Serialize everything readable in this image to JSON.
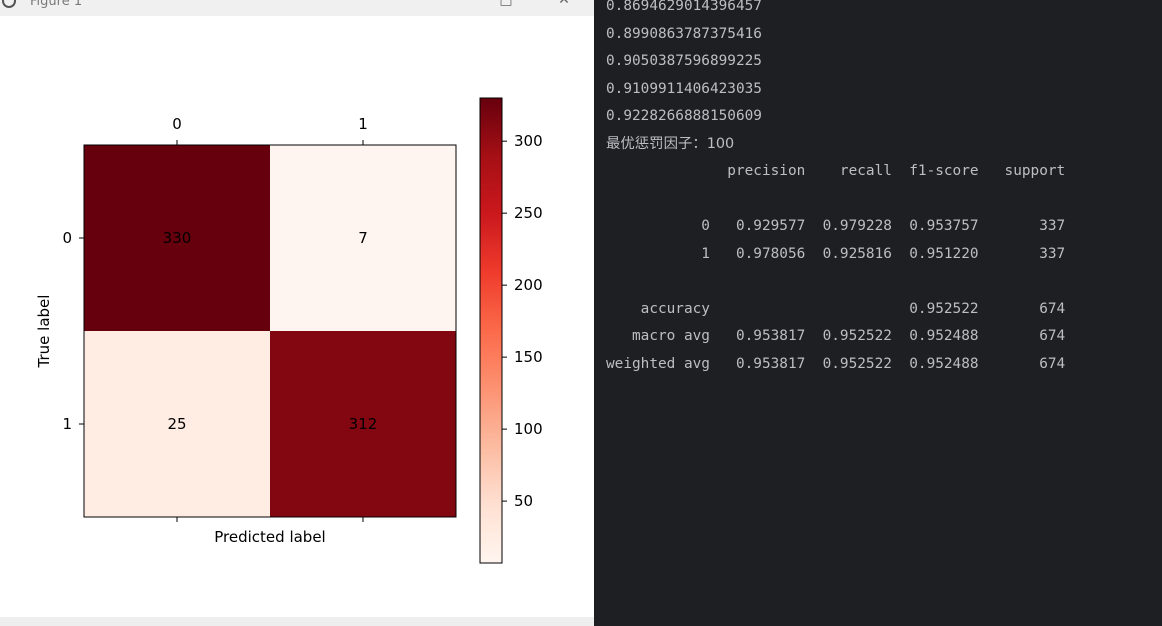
{
  "window": {
    "title": "Figure 1",
    "maximize_glyph": "□",
    "close_glyph": "✕"
  },
  "chart_data": {
    "type": "heatmap",
    "x_categories": [
      "0",
      "1"
    ],
    "y_categories": [
      "0",
      "1"
    ],
    "values": [
      [
        330,
        7
      ],
      [
        25,
        312
      ]
    ],
    "xlabel": "Predicted label",
    "ylabel": "True label",
    "colorbar": {
      "ticks": [
        50,
        100,
        150,
        200,
        250,
        300
      ],
      "range": [
        7,
        330
      ],
      "colormap": "Reds"
    },
    "x_tick_position": "top"
  },
  "terminal": {
    "lines": [
      "0.8694629014396457",
      "0.8990863787375416",
      "0.9050387596899225",
      "0.9109911406423035",
      "0.9228266888150609",
      "最优惩罚因子：100",
      "              precision    recall  f1-score   support",
      "",
      "           0   0.929577  0.979228  0.953757       337",
      "           1   0.978056  0.925816  0.951220       337",
      "",
      "    accuracy                       0.952522       674",
      "   macro avg   0.953817  0.952522  0.952488       674",
      "weighted avg   0.953817  0.952522  0.952488       674"
    ]
  },
  "colors": {
    "terminal_bg": "#1e1f22",
    "terminal_text": "#bcbec4",
    "figure_bg": "#ffffff"
  }
}
